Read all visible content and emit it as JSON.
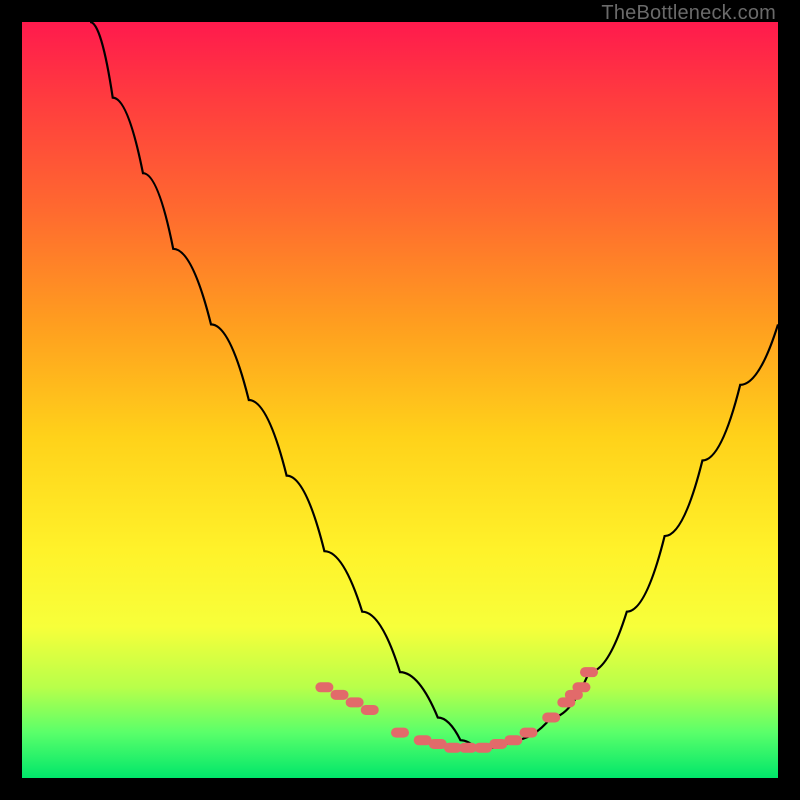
{
  "watermark": "TheBottleneck.com",
  "colors": {
    "background": "#000000",
    "gradient_top": "#ff1a4d",
    "gradient_bottom": "#00e66a",
    "curve": "#000000",
    "marker": "#e26a6a"
  },
  "chart_data": {
    "type": "line",
    "title": "",
    "xlabel": "",
    "ylabel": "",
    "xlim": [
      0,
      100
    ],
    "ylim": [
      0,
      100
    ],
    "grid": false,
    "legend": false,
    "series": [
      {
        "name": "bottleneck-curve",
        "x": [
          9,
          12,
          16,
          20,
          25,
          30,
          35,
          40,
          45,
          50,
          55,
          58,
          60,
          62,
          65,
          70,
          75,
          80,
          85,
          90,
          95,
          100
        ],
        "y": [
          100,
          90,
          80,
          70,
          60,
          50,
          40,
          30,
          22,
          14,
          8,
          5,
          4,
          4,
          5,
          8,
          14,
          22,
          32,
          42,
          52,
          60
        ]
      }
    ],
    "markers": {
      "name": "highlighted-points",
      "x": [
        40,
        42,
        44,
        46,
        50,
        53,
        55,
        57,
        59,
        61,
        63,
        65,
        67,
        70,
        72,
        73,
        74,
        75
      ],
      "y": [
        12,
        11,
        10,
        9,
        6,
        5,
        4.5,
        4,
        4,
        4,
        4.5,
        5,
        6,
        8,
        10,
        11,
        12,
        14
      ]
    }
  }
}
